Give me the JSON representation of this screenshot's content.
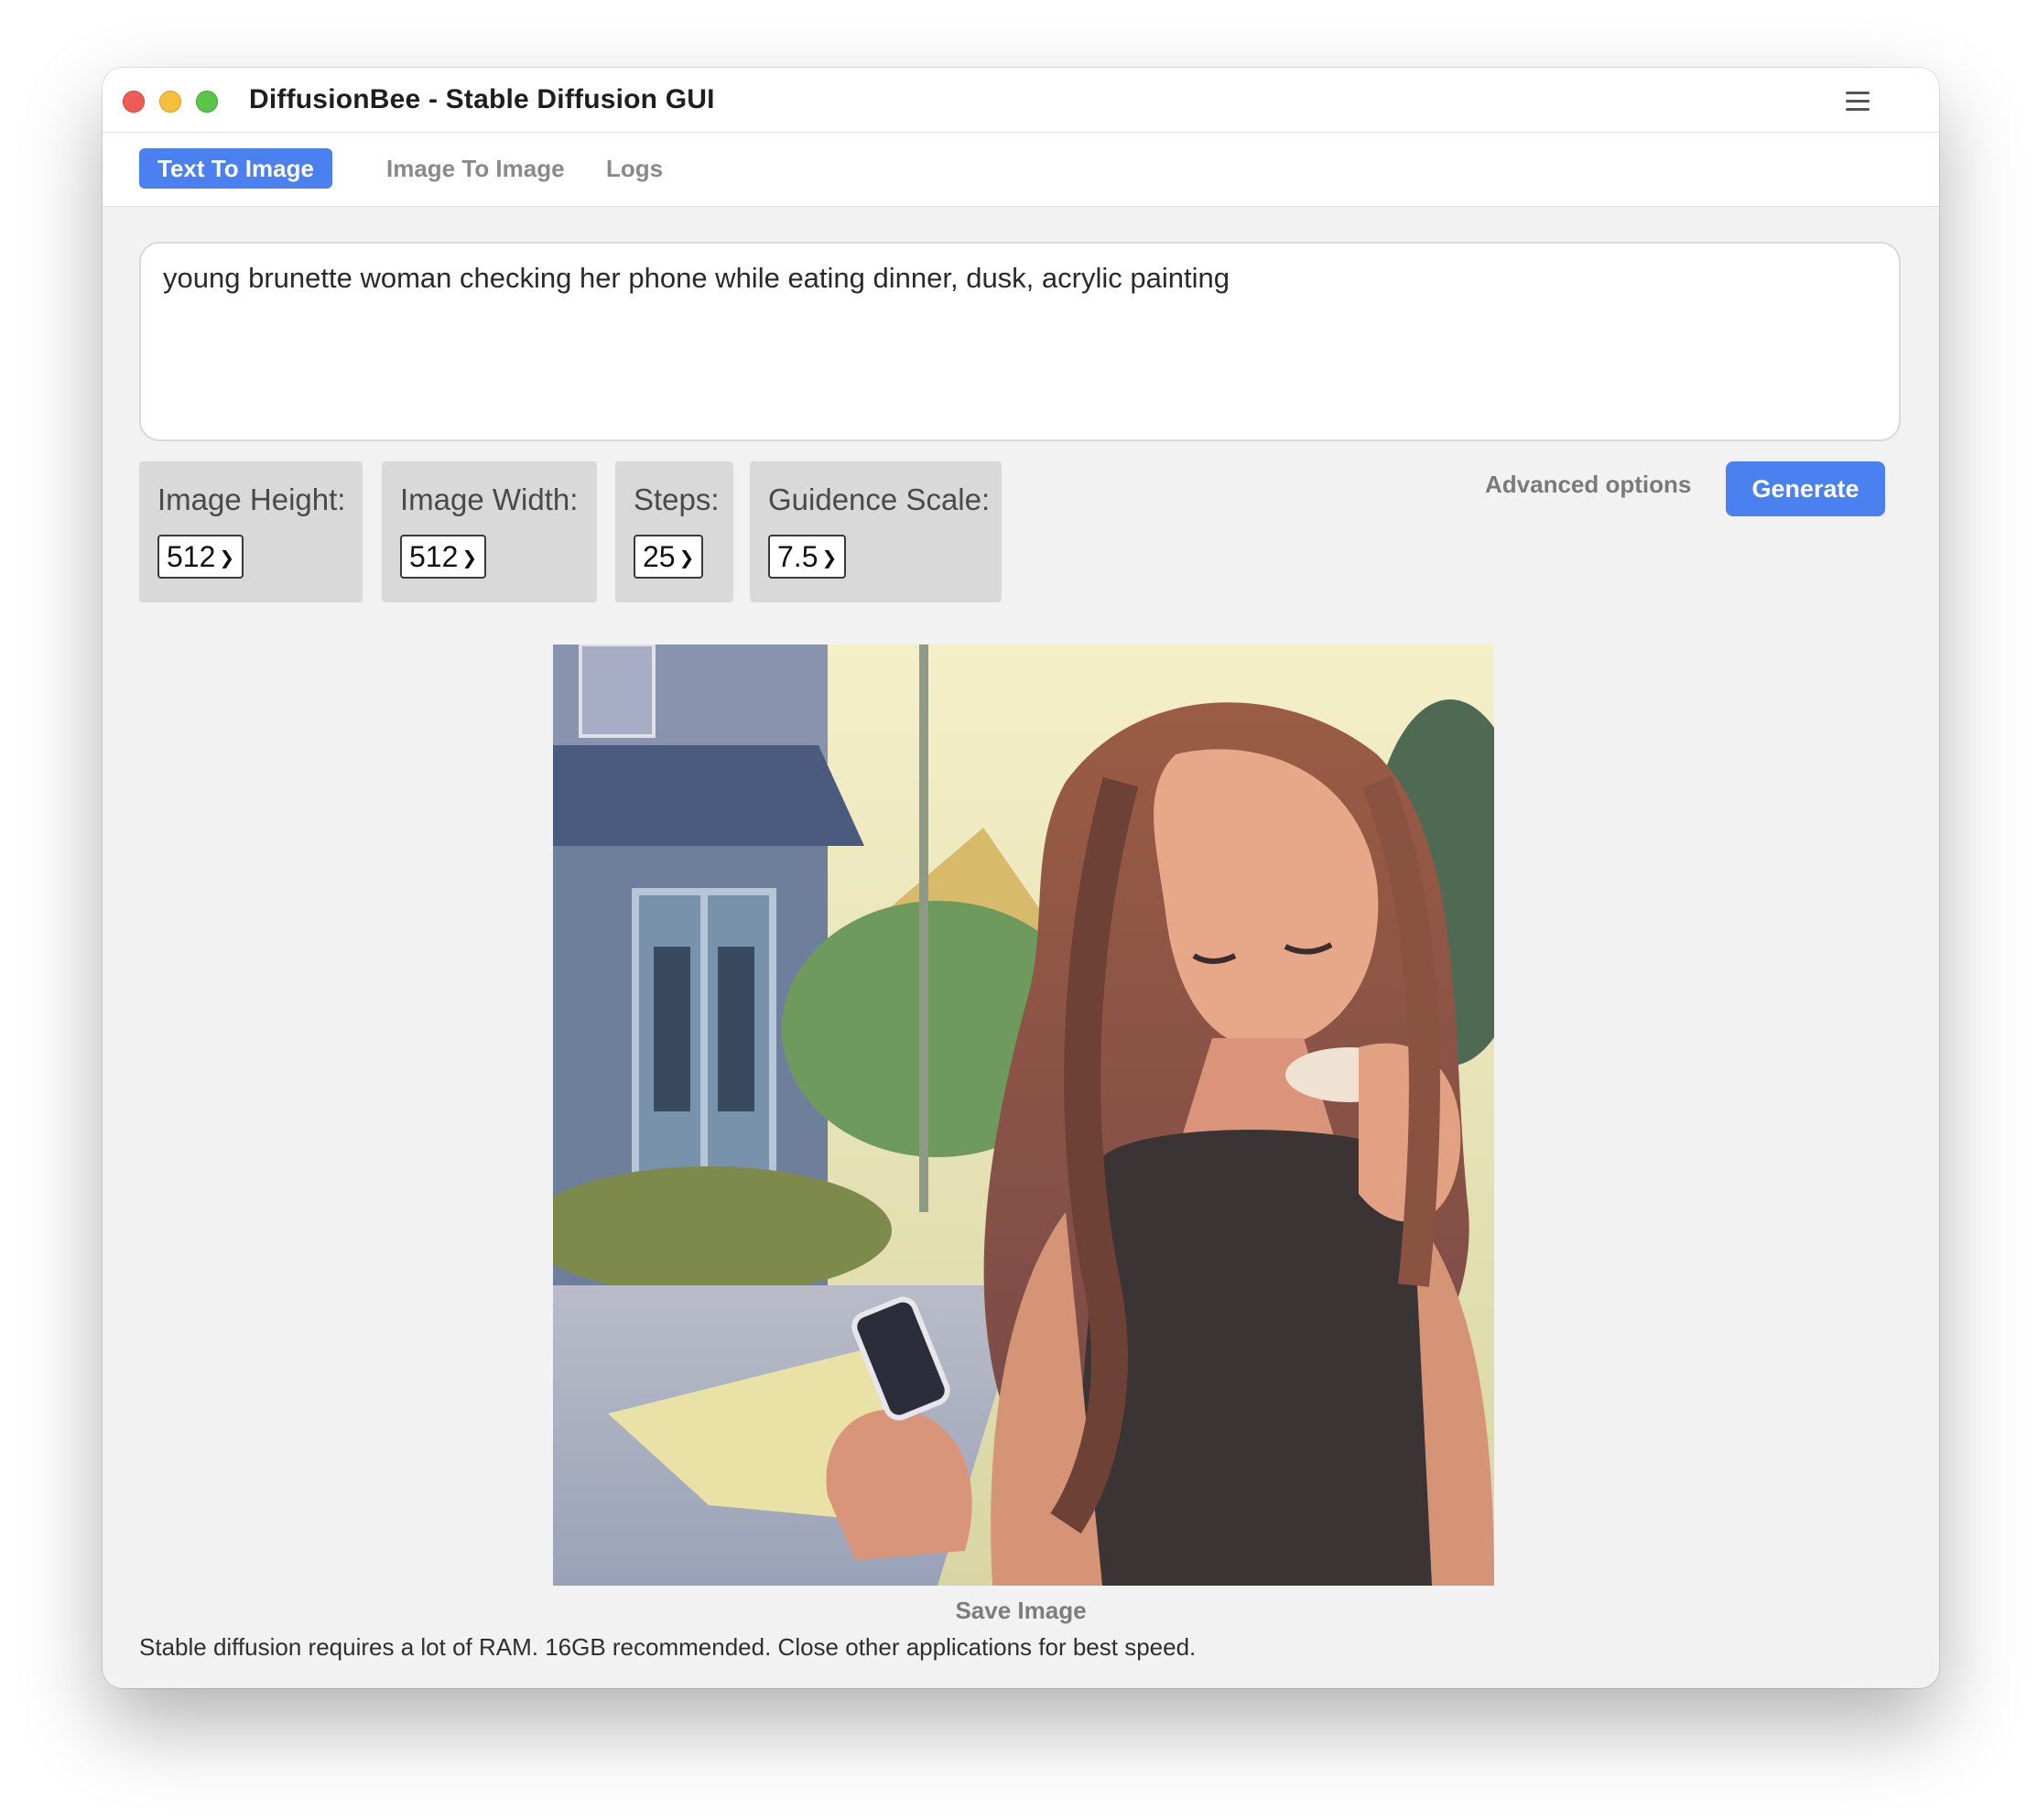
{
  "window": {
    "title": "DiffusionBee - Stable Diffusion GUI"
  },
  "tabs": [
    {
      "label": "Text To Image",
      "active": true
    },
    {
      "label": "Image To Image",
      "active": false
    },
    {
      "label": "Logs",
      "active": false
    }
  ],
  "prompt": {
    "value": "young brunette woman checking her phone while eating dinner, dusk, acrylic painting"
  },
  "options": {
    "height": {
      "label": "Image Height:",
      "value": "512"
    },
    "width": {
      "label": "Image Width:",
      "value": "512"
    },
    "steps": {
      "label": "Steps:",
      "value": "25"
    },
    "guidance": {
      "label": "Guidence Scale:",
      "value": "7.5"
    }
  },
  "actions": {
    "advanced_label": "Advanced options",
    "generate_label": "Generate",
    "save_label": "Save Image"
  },
  "footnote": "Stable diffusion requires a lot of RAM. 16GB recommended. Close other applications for best speed.",
  "colors": {
    "accent": "#4a80f0",
    "close": "#ee5c55",
    "minimize": "#f6be3b",
    "maximize": "#5ac648"
  }
}
